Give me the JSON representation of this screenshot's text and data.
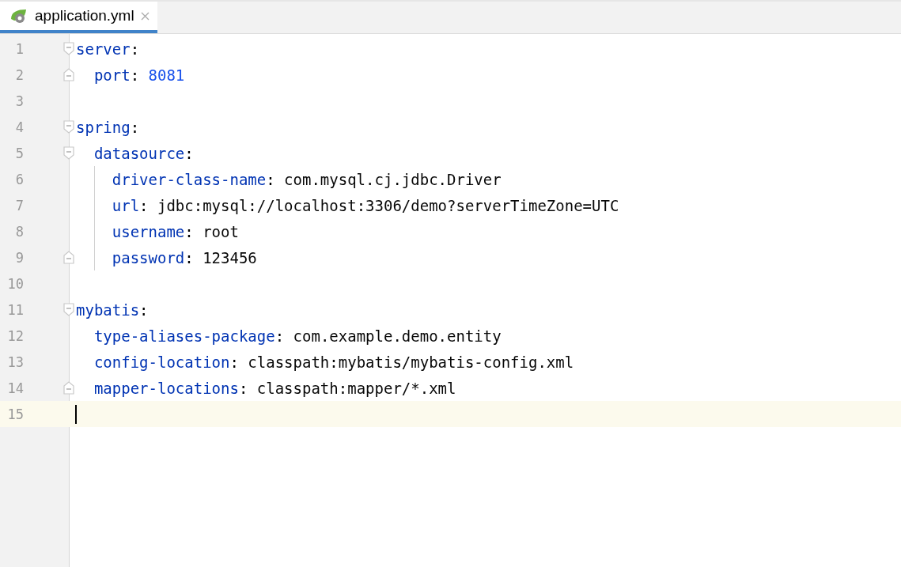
{
  "tabs": [
    {
      "label": "application.yml",
      "selected": true
    }
  ],
  "lines": [
    {
      "number": "1",
      "key": "server",
      "colon": ":",
      "fold_start": true
    },
    {
      "number": "2",
      "key": "  port",
      "colon": ":",
      "value": " 8081",
      "numeric": true,
      "fold_end": true
    },
    {
      "number": "3"
    },
    {
      "number": "4",
      "key": "spring",
      "colon": ":",
      "fold_start": true
    },
    {
      "number": "5",
      "key": "  datasource",
      "colon": ":",
      "fold_start": true
    },
    {
      "number": "6",
      "key": "    driver-class-name",
      "colon": ":",
      "value": " com.mysql.cj.jdbc.Driver",
      "guide": true
    },
    {
      "number": "7",
      "key": "    url",
      "colon": ":",
      "value": " jdbc:mysql://localhost:3306/demo?serverTimeZone=UTC",
      "guide": true
    },
    {
      "number": "8",
      "key": "    username",
      "colon": ":",
      "value": " root",
      "guide": true
    },
    {
      "number": "9",
      "key": "    password",
      "colon": ":",
      "value": " 123456",
      "guide": true,
      "fold_end": true
    },
    {
      "number": "10"
    },
    {
      "number": "11",
      "key": "mybatis",
      "colon": ":",
      "fold_start": true
    },
    {
      "number": "12",
      "key": "  type-aliases-package",
      "colon": ":",
      "value": " com.example.demo.entity"
    },
    {
      "number": "13",
      "key": "  config-location",
      "colon": ":",
      "value": " classpath:mybatis/mybatis-config.xml"
    },
    {
      "number": "14",
      "key": "  mapper-locations",
      "colon": ":",
      "value": " classpath:mapper/*.xml",
      "fold_end": true
    },
    {
      "number": "15",
      "current": true
    }
  ]
}
